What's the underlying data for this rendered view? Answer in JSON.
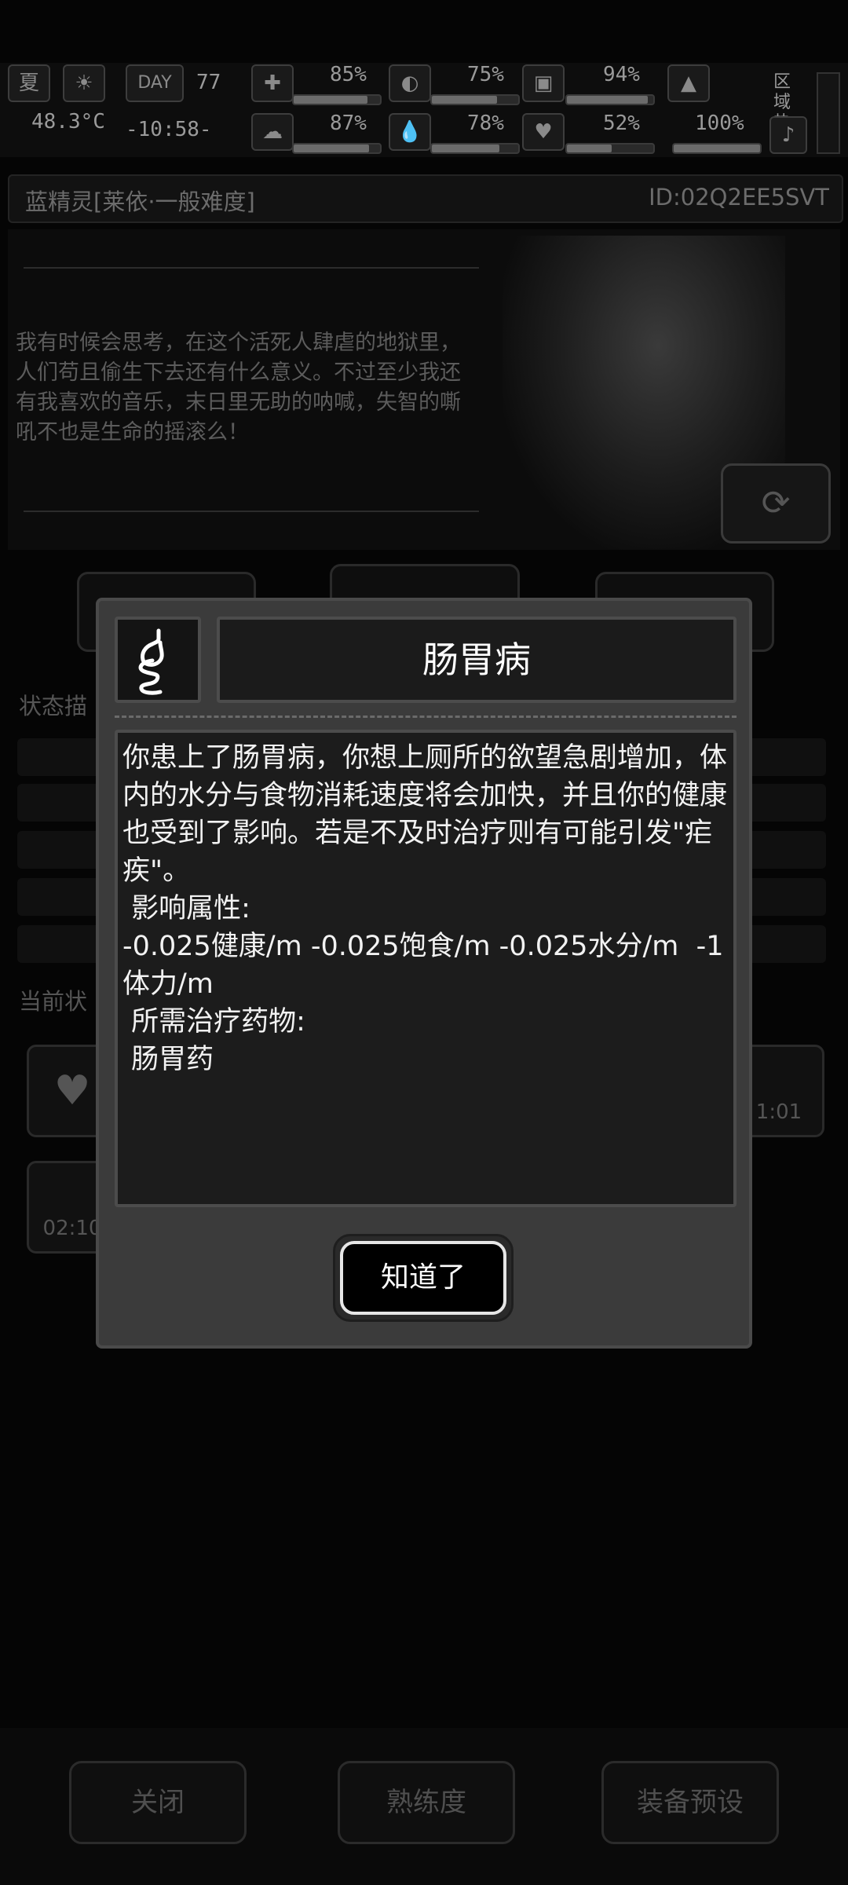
{
  "hud": {
    "season": "夏",
    "temperature": "48.3°C",
    "day_label": "DAY",
    "day_number": "77",
    "clock": "-10:58-",
    "stats_row1": [
      "85%",
      "75%",
      "94%"
    ],
    "stats_row2": [
      "87%",
      "78%",
      "52%",
      "100%"
    ],
    "stats_row1_levels": [
      0.85,
      0.75,
      0.94
    ],
    "stats_row2_levels": [
      0.87,
      0.78,
      0.52,
      1.0
    ],
    "region_label": "区域热度"
  },
  "character": {
    "name": "蓝精灵[莱依·一般难度]",
    "id": "ID:02Q2EE5SVT",
    "quote": "我有时候会思考，在这个活死人肆虐的地狱里，人们苟且偷生下去还有什么意义。不过至少我还有我喜欢的音乐，末日里无助的呐喊，失智的嘶吼不也是生命的摇滚么！"
  },
  "sections": {
    "status_desc": "状态描",
    "current_status": "当前状"
  },
  "status_timers": [
    "1:01",
    "02:10"
  ],
  "bottom_bar": {
    "close": "关闭",
    "proficiency": "熟练度",
    "equipment_preset": "装备预设"
  },
  "modal": {
    "icon": "stomach-icon",
    "title": "肠胃病",
    "body": "你患上了肠胃病，你想上厕所的欲望急剧增加，体内的水分与食物消耗速度将会加快，并且你的健康也受到了影响。若是不及时治疗则有可能引发\"疟疾\"。\n 影响属性:\n-0.025健康/m -0.025饱食/m -0.025水分/m  -1体力/m\n 所需治疗药物:\n 肠胃药",
    "ok_label": "知道了"
  }
}
